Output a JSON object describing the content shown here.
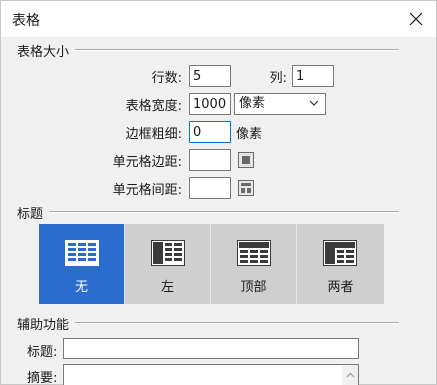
{
  "window": {
    "title": "表格"
  },
  "table_size": {
    "section_label": "表格大小",
    "rows_label": "行数:",
    "rows_value": "5",
    "cols_label": "列:",
    "cols_value": "1",
    "width_label": "表格宽度:",
    "width_value": "1000",
    "width_unit_selected": "像素",
    "border_label": "边框粗细:",
    "border_value": "0",
    "border_unit": "像素",
    "padding_label": "单元格边距:",
    "padding_value": "",
    "spacing_label": "单元格间距:",
    "spacing_value": ""
  },
  "header": {
    "section_label": "标题",
    "options": [
      {
        "label": "无",
        "selected": true,
        "icon": "table-no-header-icon"
      },
      {
        "label": "左",
        "selected": false,
        "icon": "table-left-header-icon"
      },
      {
        "label": "顶部",
        "selected": false,
        "icon": "table-top-header-icon"
      },
      {
        "label": "两者",
        "selected": false,
        "icon": "table-both-header-icon"
      }
    ]
  },
  "accessibility": {
    "section_label": "辅助功能",
    "caption_label": "标题:",
    "caption_value": "",
    "summary_label": "摘要:",
    "summary_value": ""
  },
  "colors": {
    "selected_option": "#2b6ccf",
    "option_bg": "#cfcfcf",
    "focus_border": "#0078d7"
  }
}
